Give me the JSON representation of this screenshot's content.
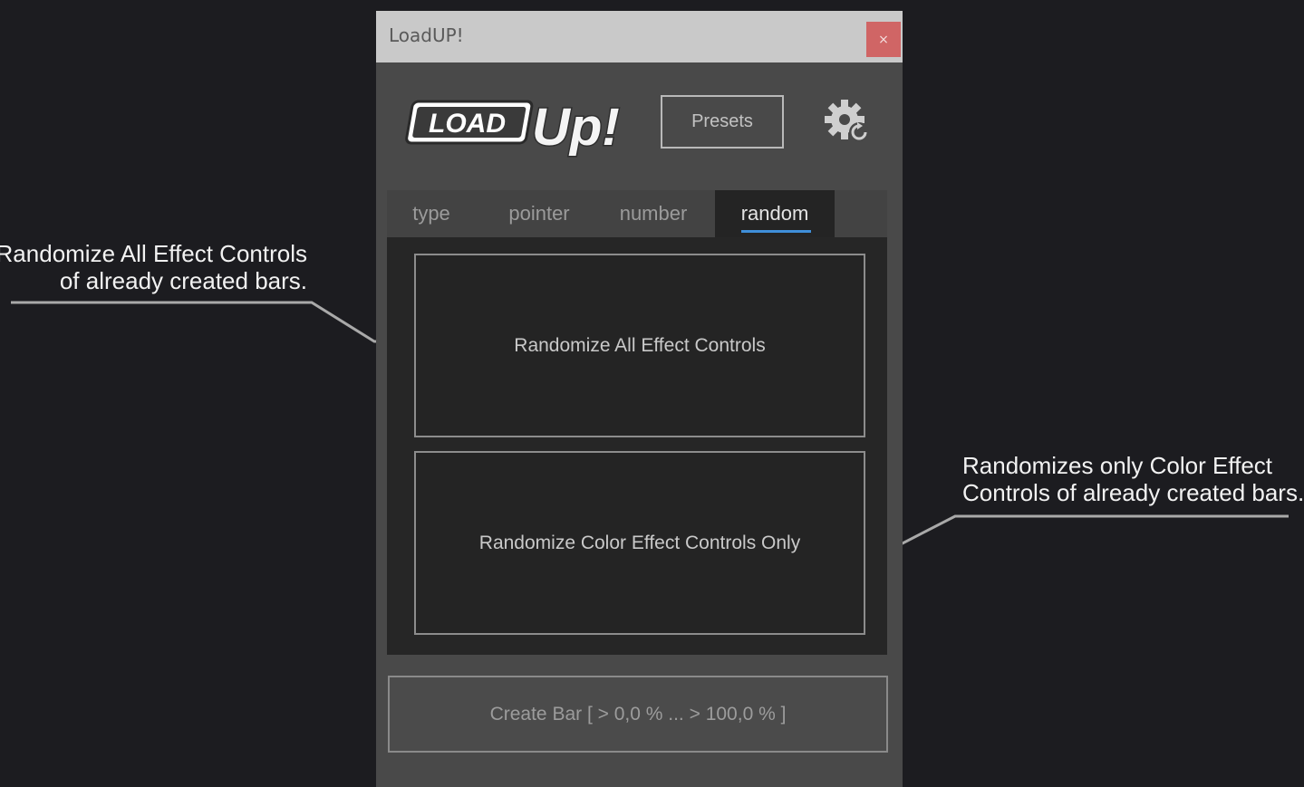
{
  "window": {
    "title": "LoadUP!",
    "close_label": "×"
  },
  "logo": {
    "text_left": "LOAD",
    "text_right": "Up!"
  },
  "header": {
    "presets_label": "Presets",
    "settings_icon": "gear-refresh-icon"
  },
  "tabs": [
    {
      "label": "type",
      "active": false
    },
    {
      "label": "pointer",
      "active": false
    },
    {
      "label": "number",
      "active": false
    },
    {
      "label": "random",
      "active": true
    }
  ],
  "random_tab": {
    "randomize_all_label": "Randomize All Effect Controls",
    "randomize_color_label": "Randomize Color Effect Controls Only"
  },
  "footer": {
    "create_bar_label": "Create Bar [ > 0,0 %  ...  > 100,0 % ]"
  },
  "annotations": {
    "left": [
      "Randomize All Effect Controls",
      "of already created bars."
    ],
    "right": [
      "Randomizes only Color Effect",
      "Controls of already created bars."
    ]
  },
  "colors": {
    "background": "#1c1c20",
    "panel": "#494949",
    "tab_active_underline": "#3f8fd9",
    "close_button": "#d06565"
  }
}
